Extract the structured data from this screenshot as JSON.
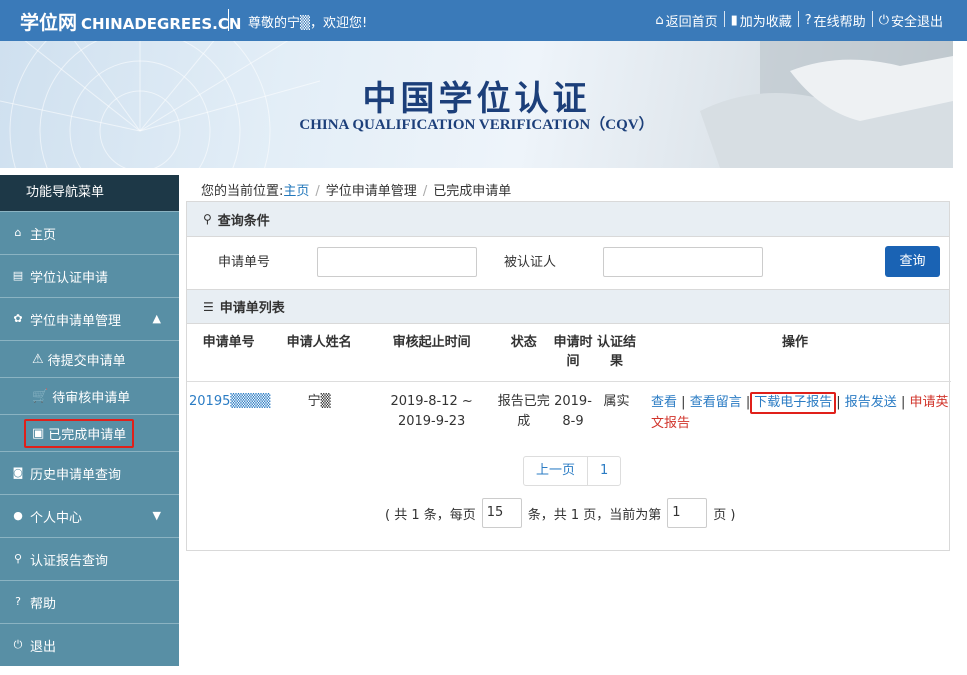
{
  "topbar": {
    "logo_cn": "学位网",
    "logo_en": "CHINADEGREES.CN",
    "greeting": "尊敬的宁▒，欢迎您!",
    "links": [
      {
        "label": "返回首页",
        "icon": "home-icon"
      },
      {
        "label": "加为收藏",
        "icon": "bookmark-icon"
      },
      {
        "label": "在线帮助",
        "icon": "question-icon"
      },
      {
        "label": "安全退出",
        "icon": "power-icon"
      }
    ]
  },
  "banner": {
    "title": "中国学位认证",
    "subtitle": "CHINA QUALIFICATION VERIFICATION（CQV）"
  },
  "sidebar": {
    "header": "功能导航菜单",
    "items": [
      {
        "label": "主页",
        "icon": "home-icon"
      },
      {
        "label": "学位认证申请",
        "icon": "file-icon"
      },
      {
        "label": "学位申请单管理",
        "icon": "gear-icon"
      },
      {
        "label": "待提交申请单",
        "icon": "warning-icon"
      },
      {
        "label": "待审核申请单",
        "icon": "cart-icon"
      },
      {
        "label": "已完成申请单",
        "icon": "briefcase-icon"
      },
      {
        "label": "历史申请单查询",
        "icon": "camera-icon"
      },
      {
        "label": "个人中心",
        "icon": "user-icon"
      },
      {
        "label": "认证报告查询",
        "icon": "search-icon"
      },
      {
        "label": "帮助",
        "icon": "help-icon"
      },
      {
        "label": "退出",
        "icon": "power-icon"
      }
    ]
  },
  "breadcrumb": {
    "prefix": "您的当前位置:",
    "home": "主页",
    "level1": "学位申请单管理",
    "level2": "已完成申请单"
  },
  "query": {
    "title": "查询条件",
    "field1_label": "申请单号",
    "field1_value": "",
    "field2_label": "被认证人",
    "field2_value": "",
    "button": "查询"
  },
  "list": {
    "title": "申请单列表",
    "columns": [
      "申请单号",
      "申请人姓名",
      "审核起止时间",
      "状态",
      "申请时间",
      "认证结果",
      "操作"
    ],
    "rows": [
      {
        "id": "20195▒▒▒▒",
        "name": "宁▒",
        "period": "2019-8-12 ~ 2019-9-23",
        "status": "报告已完成",
        "apply_time": "2019-8-9",
        "result": "属实",
        "actions": [
          "查看",
          "查看留言",
          "下载电子报告",
          "报告发送",
          "申请英文报告"
        ]
      }
    ]
  },
  "pagination": {
    "prev": "上一页",
    "page": "1",
    "info_total": "( 共 1 条，每页",
    "page_size": "15",
    "info_mid": "条，共 1 页，当前为第",
    "current_page": "1",
    "info_end": "页 )"
  },
  "colors": {
    "topbar": "#3a7ab9",
    "sidebar_item": "#588fa5",
    "sidebar_header": "#1d3847",
    "highlight": "#e0201a",
    "link": "#2b7cc4"
  }
}
